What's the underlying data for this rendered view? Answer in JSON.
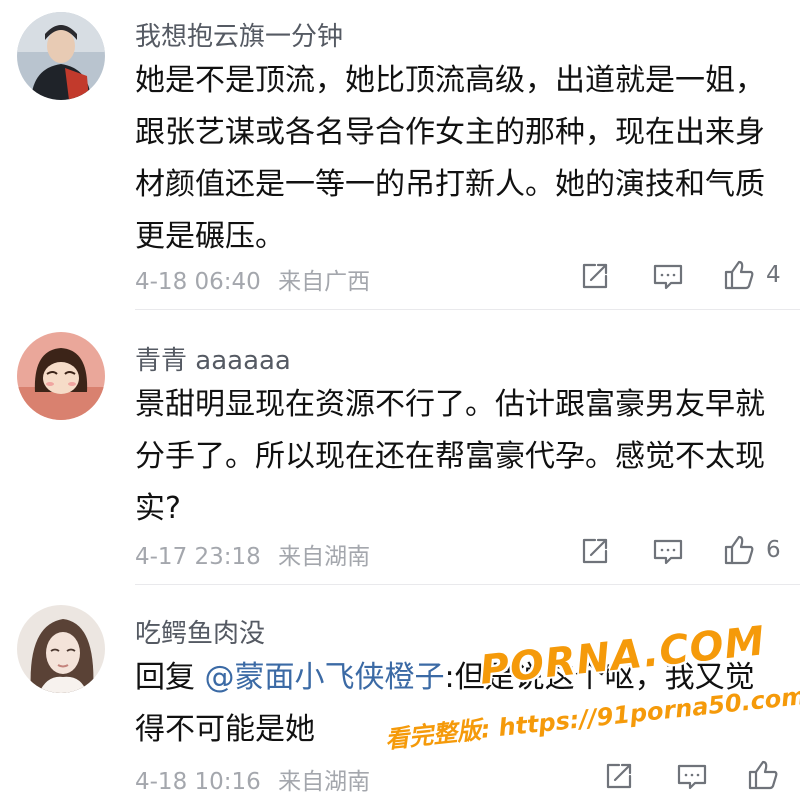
{
  "comments": [
    {
      "username": "我想抱云旗一分钟",
      "text": "她是不是顶流，她比顶流高级，出道就是一姐，跟张艺谋或各名导合作女主的那种，现在出来身材颜值还是一等一的吊打新人。她的演技和气质更是碾压。",
      "date": "4-18 06:40",
      "location": "来自广西",
      "likes": "4"
    },
    {
      "username": "青青 aaaaaa",
      "text": "景甜明显现在资源不行了。估计跟富豪男友早就分手了。所以现在还在帮富豪代孕。感觉不太现实?",
      "date": "4-17 23:18",
      "location": "来自湖南",
      "likes": "6"
    },
    {
      "username": "吃鳄鱼肉没",
      "reply_prefix": "回复",
      "mention": "@蒙面小飞侠橙子",
      "text": ":但是说这个呕，我又觉得不可能是她",
      "date": "4-18 10:16",
      "location": "来自湖南",
      "likes": ""
    }
  ],
  "watermark": {
    "logo": "PORNA.COM",
    "url": "看完整版: https://91porna50.com"
  },
  "icons": {
    "share": "share-icon",
    "comment": "comment-icon",
    "like": "thumbs-up-icon"
  },
  "colors": {
    "username": "#555a63",
    "text": "#111111",
    "meta": "#a4a7ad",
    "mention": "#3b6aa5",
    "watermark": "#f59a0a"
  }
}
